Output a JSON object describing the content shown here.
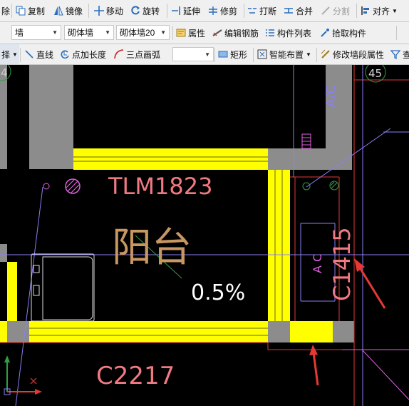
{
  "toolbar1": {
    "delete": "除",
    "copy": "复制",
    "mirror": "镜像",
    "move": "移动",
    "rotate": "旋转",
    "extend": "延伸",
    "trim": "修剪",
    "break": "打断",
    "merge": "合并",
    "split": "分割",
    "align": "对齐"
  },
  "toolbar2": {
    "category_select": "墙",
    "type_select": "砌体墙",
    "component_select": "砌体墙20",
    "properties": "属性",
    "edit_rebar": "编辑钢筋",
    "component_list": "构件列表",
    "pick_component": "拾取构件"
  },
  "toolbar3": {
    "select_tail": "择",
    "line": "直线",
    "add_length": "点加长度",
    "arc_3pt": "三点画弧",
    "arc_select": "",
    "rectangle": "矩形",
    "smart_layout": "智能布置",
    "edit_wall_props": "修改墙段属性",
    "find_tail": "查"
  },
  "drawing": {
    "door_label": "TLM1823",
    "room_label": "阳台",
    "slope_label": "0.5%",
    "window_label_bottom": "C2217",
    "window_label_right": "C1415",
    "axis_left": "4",
    "axis_right": "45",
    "annot_ac_top": "A/C",
    "annot_ac_mid": "A C"
  },
  "colors": {
    "background": "#000000",
    "wall_gray": "#8c8c8c",
    "wall_yellow": "#ffff00",
    "label_pink": "#f07a82",
    "room_tan": "#c89660",
    "arrow_red": "#e53935",
    "magenta": "#e060e0",
    "axis_purple": "#8a7ff5",
    "axis_green": "#2ea043"
  }
}
